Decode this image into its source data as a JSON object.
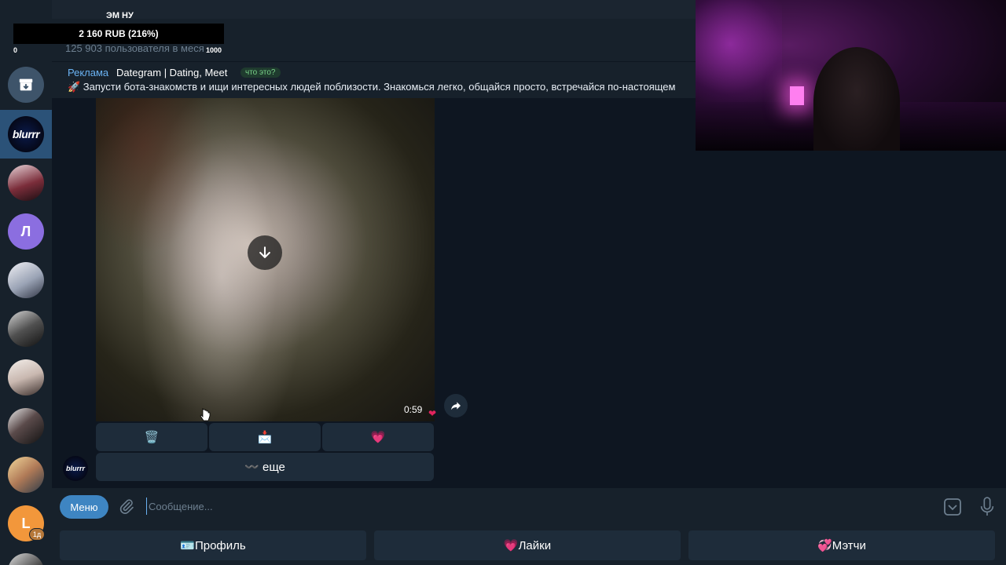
{
  "header": {
    "channel_title": "ЭМ НУ",
    "subscribers": "125 903 пользователя в меся"
  },
  "donation": {
    "amount": "2 160 RUB (216%)",
    "min": "0",
    "max": "1000"
  },
  "ad": {
    "label": "Реклама",
    "name": "Dategram | Dating, Meet",
    "chip": "что это?",
    "text": "🚀 Запусти бота-знакомств и ищи интересных людей поблизости. Знакомься легко, общайся просто, встречайся по-настоящем"
  },
  "sidebar": {
    "items": [
      {
        "icon": "archive-icon"
      },
      {
        "label": "blurrr",
        "active": true
      },
      {
        "label": ""
      },
      {
        "label": "Л"
      },
      {
        "label": ""
      },
      {
        "label": ""
      },
      {
        "label": ""
      },
      {
        "label": ""
      },
      {
        "label": ""
      },
      {
        "label": "L",
        "badge": "1д"
      },
      {
        "label": ""
      }
    ]
  },
  "video": {
    "duration": "0:59",
    "reaction": "❤"
  },
  "inline_keyboard": {
    "row1": [
      "🗑️",
      "📩",
      "💗"
    ],
    "row2": "〰️ еще"
  },
  "sender_avatar_label": "blurrr",
  "compose": {
    "menu_label": "Меню",
    "placeholder": "Сообщение..."
  },
  "reply_keyboard": [
    "🪪Профиль",
    "💗Лайки",
    "💞Мэтчи"
  ],
  "colors": {
    "accent": "#3e85c2",
    "background": "#0e1621",
    "panel": "#17212b",
    "button": "#1e2c3a"
  }
}
